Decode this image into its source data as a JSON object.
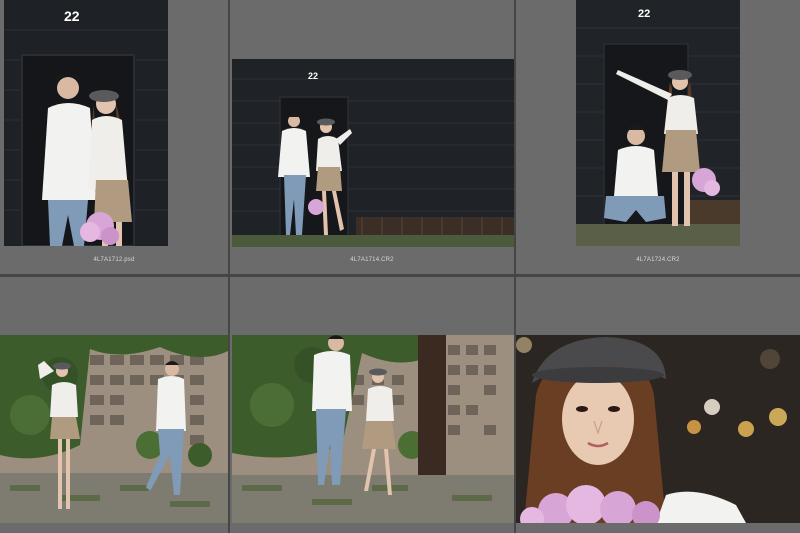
{
  "thumbnails": [
    {
      "filename": "4L7A1712.psd",
      "door_number": "22"
    },
    {
      "filename": "4L7A1714.CR2",
      "door_number": "22"
    },
    {
      "filename": "4L7A1724.CR2",
      "door_number": "22"
    },
    {
      "filename": ""
    },
    {
      "filename": ""
    },
    {
      "filename": ""
    }
  ],
  "colors": {
    "background": "#464646",
    "cell": "#6b6b6b",
    "label": "#d8d8d8",
    "wall": "#1e2126",
    "jacket": "#f2f2f0",
    "jeans": "#7f9bb8",
    "skirt": "#b09a80",
    "flowers": "#d8a6d6",
    "foliage": "#3d5c2c"
  }
}
